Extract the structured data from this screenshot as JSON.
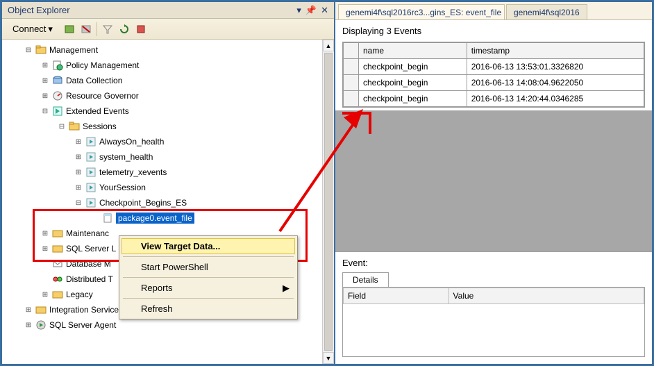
{
  "left": {
    "title": "Object Explorer",
    "connect_label": "Connect",
    "tree": {
      "management": "Management",
      "policy": "Policy Management",
      "data_collection": "Data Collection",
      "resource_governor": "Resource Governor",
      "extended_events": "Extended Events",
      "sessions": "Sessions",
      "always_on": "AlwaysOn_health",
      "system_health": "system_health",
      "telemetry": "telemetry_xevents",
      "your_session": "YourSession",
      "checkpoint_begins": "Checkpoint_Begins_ES",
      "package0": "package0.event_file",
      "maintenance": "Maintenanc",
      "sql_server_l": "SQL Server L",
      "database_m": "Database M",
      "distributed": "Distributed T",
      "legacy": "Legacy",
      "integration": "Integration Services Catalogs",
      "sql_agent": "SQL Server Agent"
    },
    "context_menu": {
      "view_target_data": "View Target Data...",
      "start_powershell": "Start PowerShell",
      "reports": "Reports",
      "refresh": "Refresh"
    }
  },
  "right": {
    "tab_active": "genemi4f\\sql2016rc3...gins_ES: event_file",
    "tab_other": "genemi4f\\sql2016",
    "display_header": "Displaying 3 Events",
    "columns": {
      "name": "name",
      "timestamp": "timestamp"
    },
    "rows": [
      {
        "name": "checkpoint_begin",
        "timestamp": "2016-06-13 13:53:01.3326820"
      },
      {
        "name": "checkpoint_begin",
        "timestamp": "2016-06-13 14:08:04.9622050"
      },
      {
        "name": "checkpoint_begin",
        "timestamp": "2016-06-13 14:20:44.0346285"
      }
    ],
    "event_label": "Event:",
    "details_tab": "Details",
    "detail_cols": {
      "field": "Field",
      "value": "Value"
    }
  }
}
